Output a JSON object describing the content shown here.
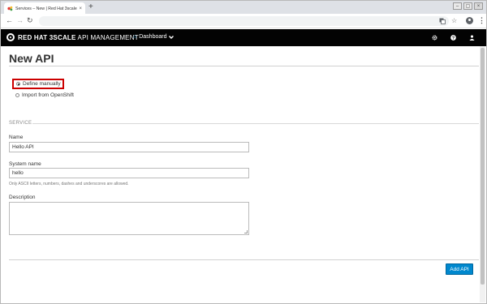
{
  "browser": {
    "tab_title": "Services – New | Red Hat 3scale",
    "tab_close": "×",
    "new_tab": "+",
    "window_controls": [
      "–",
      "▢",
      "×"
    ],
    "nav": {
      "back": "←",
      "forward": "→",
      "reload": "↻"
    },
    "toolbar_icons": [
      "translate-icon",
      "star-icon",
      "account-icon",
      "menu-icon"
    ]
  },
  "navbar": {
    "brand_bold": "RED HAT 3SCALE",
    "brand_rest": " API MANAGEMENT",
    "dashboard_label": "Dashboard",
    "icons": [
      "gear-icon",
      "help-icon",
      "user-icon"
    ]
  },
  "page": {
    "title": "New API",
    "options": [
      {
        "label": "Define manually",
        "selected": true
      },
      {
        "label": "Import from OpenShift",
        "selected": false
      }
    ],
    "section": "SERVICE",
    "fields": {
      "name_label": "Name",
      "name_value": "Hello API",
      "system_name_label": "System name",
      "system_name_value": "hello",
      "system_name_help": "Only ASCII letters, numbers, dashes and underscores are allowed.",
      "description_label": "Description",
      "description_value": ""
    },
    "submit": "Add API"
  },
  "colors": {
    "navbar_bg": "#030303",
    "primary_button": "#0088ce",
    "highlight_border": "#cc0000",
    "home_icon": "#39a5dc"
  }
}
